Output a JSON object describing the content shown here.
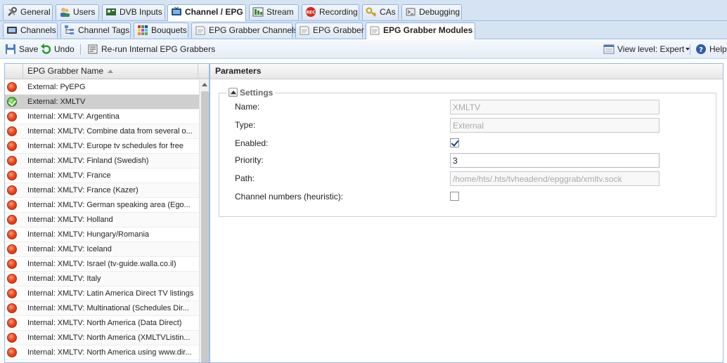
{
  "tabs_main": [
    {
      "label": "General",
      "icon": "wrench-icon",
      "active": false
    },
    {
      "label": "Users",
      "icon": "users-icon",
      "active": false
    },
    {
      "label": "DVB Inputs",
      "icon": "dvb-card-icon",
      "active": false
    },
    {
      "label": "Channel / EPG",
      "icon": "tv-icon",
      "active": true
    },
    {
      "label": "Stream",
      "icon": "stream-icon",
      "active": false
    },
    {
      "label": "Recording",
      "icon": "rec-icon",
      "active": false
    },
    {
      "label": "CAs",
      "icon": "key-icon",
      "active": false
    },
    {
      "label": "Debugging",
      "icon": "debug-icon",
      "active": false
    }
  ],
  "tabs_sub": [
    {
      "label": "Channels",
      "icon": "channels-icon",
      "active": false
    },
    {
      "label": "Channel Tags",
      "icon": "tree-icon",
      "active": false
    },
    {
      "label": "Bouquets",
      "icon": "bouquets-icon",
      "active": false
    },
    {
      "label": "EPG Grabber Channels",
      "icon": "epg-icon",
      "active": false
    },
    {
      "label": "EPG Grabber",
      "icon": "epg-icon",
      "active": false
    },
    {
      "label": "EPG Grabber Modules",
      "icon": "epg-icon",
      "active": true
    }
  ],
  "toolbar": {
    "save": "Save",
    "undo": "Undo",
    "rerun": "Re-run Internal EPG Grabbers",
    "view_level": "View level: Expert",
    "help": "Help"
  },
  "grid": {
    "column_header": "EPG Grabber Name",
    "rows": [
      {
        "name": "External: PyEPG",
        "status": "red",
        "selected": false
      },
      {
        "name": "External: XMLTV",
        "status": "green",
        "selected": true
      },
      {
        "name": "Internal: XMLTV: Argentina",
        "status": "red",
        "selected": false
      },
      {
        "name": "Internal: XMLTV: Combine data from several o...",
        "status": "red",
        "selected": false
      },
      {
        "name": "Internal: XMLTV: Europe tv schedules for free",
        "status": "red",
        "selected": false
      },
      {
        "name": "Internal: XMLTV: Finland (Swedish)",
        "status": "red",
        "selected": false
      },
      {
        "name": "Internal: XMLTV: France",
        "status": "red",
        "selected": false
      },
      {
        "name": "Internal: XMLTV: France (Kazer)",
        "status": "red",
        "selected": false
      },
      {
        "name": "Internal: XMLTV: German speaking area (Ego...",
        "status": "red",
        "selected": false
      },
      {
        "name": "Internal: XMLTV: Holland",
        "status": "red",
        "selected": false
      },
      {
        "name": "Internal: XMLTV: Hungary/Romania",
        "status": "red",
        "selected": false
      },
      {
        "name": "Internal: XMLTV: Iceland",
        "status": "red",
        "selected": false
      },
      {
        "name": "Internal: XMLTV: Israel (tv-guide.walla.co.il)",
        "status": "red",
        "selected": false
      },
      {
        "name": "Internal: XMLTV: Italy",
        "status": "red",
        "selected": false
      },
      {
        "name": "Internal: XMLTV: Latin America Direct TV listings",
        "status": "red",
        "selected": false
      },
      {
        "name": "Internal: XMLTV: Multinational (Schedules Dir...",
        "status": "red",
        "selected": false
      },
      {
        "name": "Internal: XMLTV: North America (Data Direct)",
        "status": "red",
        "selected": false
      },
      {
        "name": "Internal: XMLTV: North America (XMLTVListin...",
        "status": "red",
        "selected": false
      },
      {
        "name": "Internal: XMLTV: North America using www.dir...",
        "status": "red",
        "selected": false
      }
    ]
  },
  "params": {
    "title": "Parameters",
    "legend": "Settings",
    "name_label": "Name:",
    "name_value": "XMLTV",
    "type_label": "Type:",
    "type_value": "External",
    "enabled_label": "Enabled:",
    "enabled_checked": true,
    "priority_label": "Priority:",
    "priority_value": "3",
    "path_label": "Path:",
    "path_value": "/home/hts/.hts/tvheadend/epggrab/xmltv.sock",
    "channel_numbers_label": "Channel numbers (heuristic):",
    "channel_numbers_checked": false
  }
}
